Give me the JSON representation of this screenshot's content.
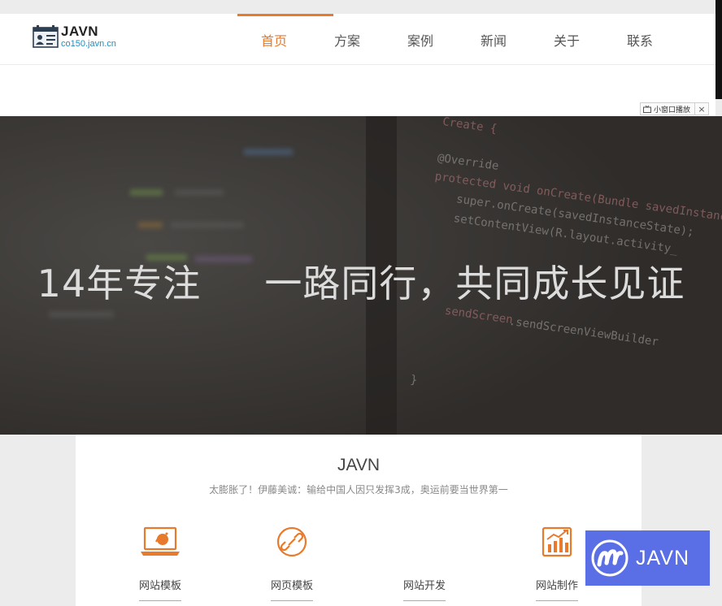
{
  "header": {
    "logo_title": "JAVN",
    "logo_subtitle": "co150.javn.cn",
    "nav": [
      {
        "label": "首页",
        "active": true
      },
      {
        "label": "方案",
        "active": false
      },
      {
        "label": "案例",
        "active": false
      },
      {
        "label": "新闻",
        "active": false
      },
      {
        "label": "关于",
        "active": false
      },
      {
        "label": "联系",
        "active": false
      }
    ],
    "accent_color": "#e77a2c"
  },
  "mini_player": {
    "label": "小窗口播放",
    "close": "×",
    "icon": "tv-icon"
  },
  "hero": {
    "headline": "14年专注     一路同行，共同成长见证",
    "code_lines": [
      "Create {",
      "@Override",
      "protected void onCreate(Bundle savedInstance",
      "super.onCreate(savedInstanceState);",
      "setContentView(R.layout.activity_",
      "}",
      "sendScreen",
      "}"
    ]
  },
  "intro": {
    "title": "JAVN",
    "subtitle": "太膨胀了！伊藤美诚：输给中国人因只发挥3成，奥运前要当世界第一"
  },
  "services": [
    {
      "label": "网站模板",
      "icon": "laptop-icon"
    },
    {
      "label": "网页模板",
      "icon": "link-circle-icon"
    },
    {
      "label": "网站开发",
      "icon": "code-icon"
    },
    {
      "label": "网站制作",
      "icon": "chart-icon"
    }
  ],
  "badge": {
    "text": "JAVN",
    "color": "#5a6fe6"
  }
}
